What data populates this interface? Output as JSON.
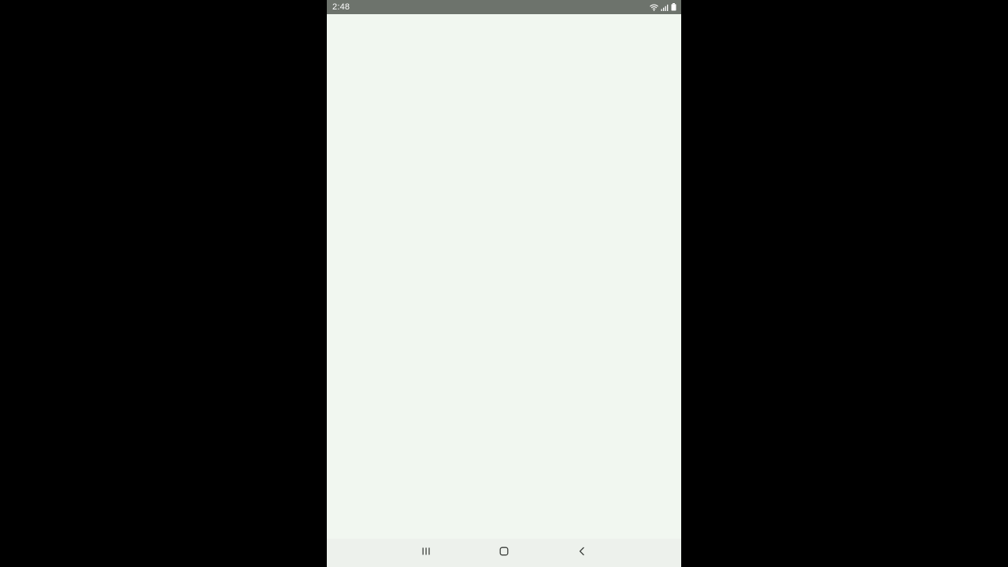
{
  "status_bar": {
    "time": "2:48",
    "icons": [
      "wifi-icon",
      "signal-icon",
      "battery-icon"
    ]
  },
  "navigation_bar": {
    "buttons": [
      "recents-icon",
      "home-icon",
      "back-icon"
    ]
  },
  "colors": {
    "outer_background": "#000000",
    "status_bar": "#6d736c",
    "screen_background": "#f1f7f0",
    "nav_bar": "#edf1ec",
    "nav_icon": "#3c3f3b"
  }
}
